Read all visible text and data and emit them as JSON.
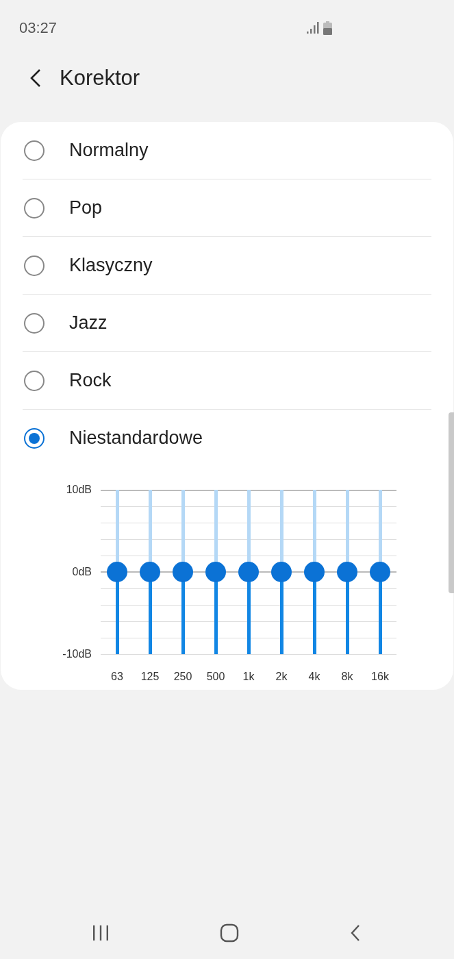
{
  "status_bar": {
    "time": "03:27"
  },
  "header": {
    "title": "Korektor"
  },
  "presets": [
    {
      "label": "Normalny",
      "selected": false
    },
    {
      "label": "Pop",
      "selected": false
    },
    {
      "label": "Klasyczny",
      "selected": false
    },
    {
      "label": "Jazz",
      "selected": false
    },
    {
      "label": "Rock",
      "selected": false
    },
    {
      "label": "Niestandardowe",
      "selected": true
    }
  ],
  "equalizer": {
    "axis_labels": [
      "10dB",
      "0dB",
      "-10dB"
    ],
    "bands": [
      {
        "label": "63",
        "level": 0.5
      },
      {
        "label": "125",
        "level": 0.5
      },
      {
        "label": "250",
        "level": 0.5
      },
      {
        "label": "500",
        "level": 0.5
      },
      {
        "label": "1k",
        "level": 0.5
      },
      {
        "label": "2k",
        "level": 0.5
      },
      {
        "label": "4k",
        "level": 0.5
      },
      {
        "label": "8k",
        "level": 0.5
      },
      {
        "label": "16k",
        "level": 0.5
      }
    ]
  }
}
